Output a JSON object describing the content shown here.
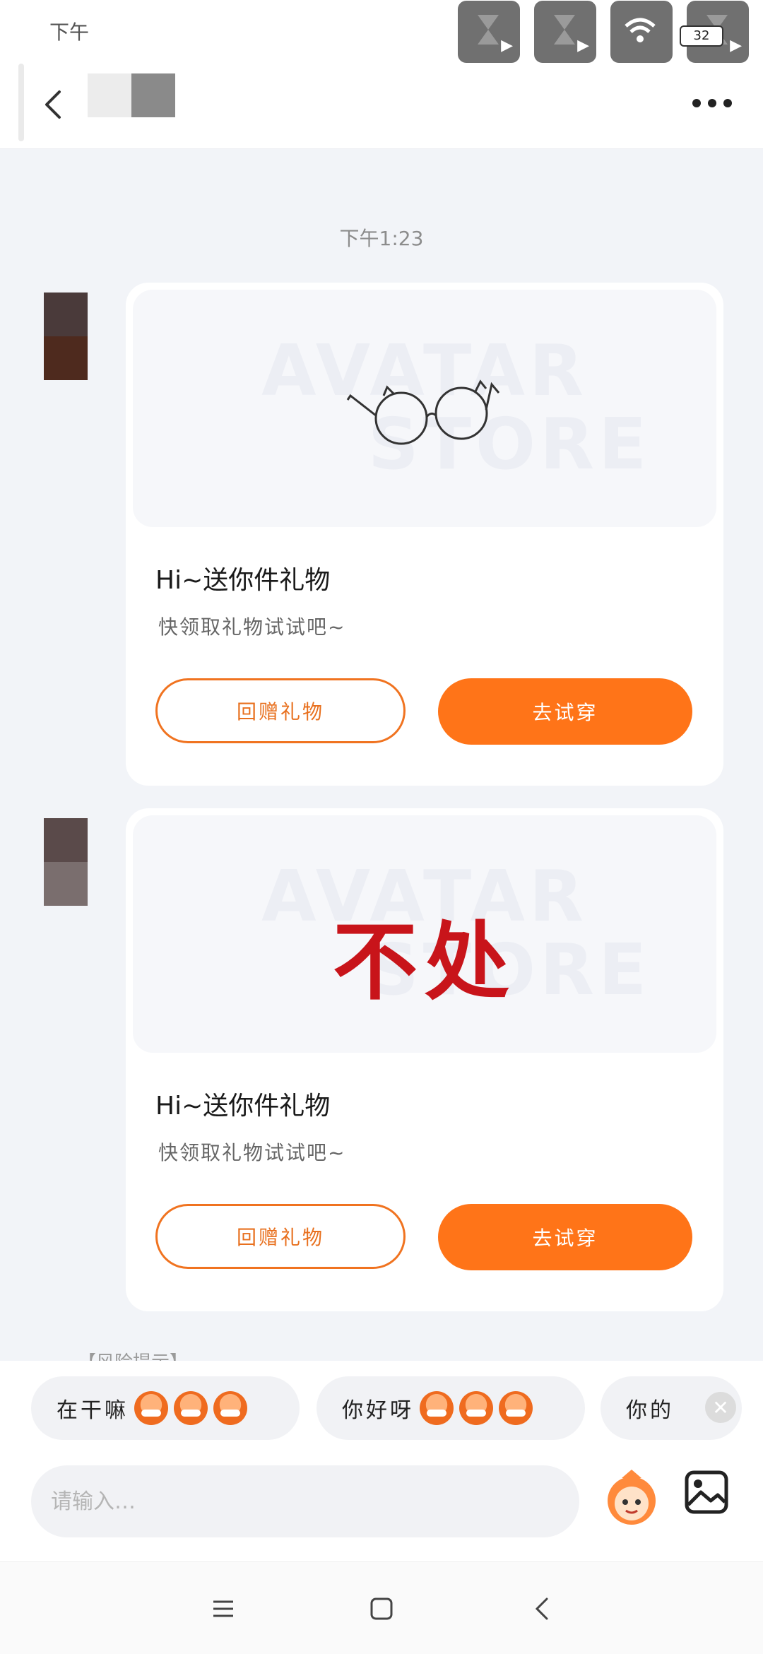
{
  "status_bar": {
    "time": "下午",
    "battery": "32"
  },
  "header": {
    "back_icon": "chevron-left-icon",
    "more_icon": "more-dots-icon"
  },
  "chat": {
    "timestamp": "下午1:23",
    "messages": [
      {
        "image_text": "",
        "watermark_top": "AVATAR",
        "watermark_bottom": "STORE",
        "title": "Hi~送你件礼物",
        "subtitle": "快领取礼物试试吧~",
        "return_gift_label": "回赠礼物",
        "try_on_label": "去试穿"
      },
      {
        "image_text": "不处",
        "watermark_top": "AVATAR",
        "watermark_bottom": "STORE",
        "title": "Hi~送你件礼物",
        "subtitle": "快领取礼物试试吧~",
        "return_gift_label": "回赠礼物",
        "try_on_label": "去试穿"
      }
    ],
    "risk_notice": "【风险提示】"
  },
  "quick_replies": [
    {
      "label": "在干嘛"
    },
    {
      "label": "你好呀"
    },
    {
      "label": "你的"
    }
  ],
  "composer": {
    "placeholder": "请输入…",
    "sticker_icon": "sticker-icon",
    "image_icon": "image-icon"
  },
  "nav": {
    "menu_icon": "menu-icon",
    "home_icon": "home-icon",
    "back_icon": "back-icon"
  },
  "colors": {
    "accent": "#ff7418",
    "background": "#f2f4f8",
    "card": "#ffffff"
  }
}
